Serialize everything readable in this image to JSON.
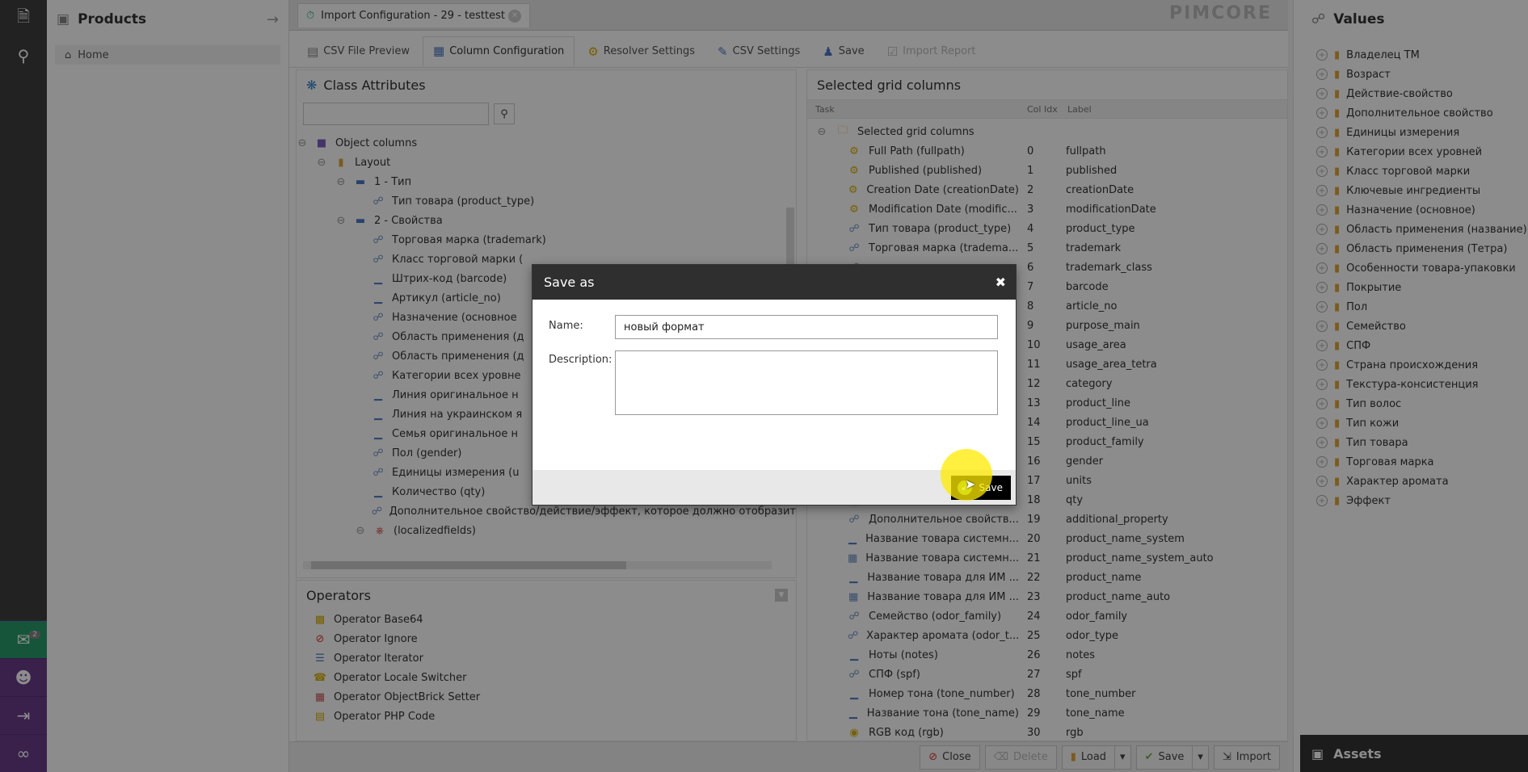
{
  "app": {
    "left_panel_title": "Products",
    "home_label": "Home",
    "active_tab_title": "Import Configuration - 29 - testtest",
    "logo": "PIMCORE",
    "comments_badge": "2"
  },
  "subtabs": [
    {
      "label": "CSV File Preview"
    },
    {
      "label": "Column Configuration"
    },
    {
      "label": "Resolver Settings"
    },
    {
      "label": "CSV Settings"
    },
    {
      "label": "Save"
    },
    {
      "label": "Import Report"
    }
  ],
  "class_attributes": {
    "title": "Class Attributes",
    "tree": [
      {
        "label": "Object columns",
        "icon": "cube-icon"
      },
      {
        "label": "Layout",
        "icon": "folder-icon"
      },
      {
        "label": "1 - Тип",
        "icon": "layout-icon"
      },
      {
        "label": "Тип товара (product_type)",
        "icon": "relation-icon"
      },
      {
        "label": "2 - Свойства",
        "icon": "layout-icon"
      },
      {
        "label": "Торговая марка (trademark)",
        "icon": "relation-icon"
      },
      {
        "label": "Класс торговой марки (",
        "icon": "relation-icon"
      },
      {
        "label": "Штрих-код (barcode)",
        "icon": "input-icon"
      },
      {
        "label": "Артикул (article_no)",
        "icon": "input-icon"
      },
      {
        "label": "Назначение (основное",
        "icon": "relation-icon"
      },
      {
        "label": "Область применения (д",
        "icon": "relation-icon"
      },
      {
        "label": "Область применения (д",
        "icon": "relation-icon"
      },
      {
        "label": "Категории всех уровне",
        "icon": "relation-icon"
      },
      {
        "label": "Линия оригинальное н",
        "icon": "input-icon"
      },
      {
        "label": "Линия на украинском я",
        "icon": "input-icon"
      },
      {
        "label": "Семья оригинальное н",
        "icon": "input-icon"
      },
      {
        "label": "Пол (gender)",
        "icon": "relation-icon"
      },
      {
        "label": "Единицы измерения (u",
        "icon": "relation-icon"
      },
      {
        "label": "Количество (qty)",
        "icon": "input-icon"
      },
      {
        "label": "Дополнительное свойство/действие/эффект, которое должно отобразит",
        "icon": "relation-icon"
      },
      {
        "label": "(localizedfields)",
        "icon": "localized-icon"
      }
    ]
  },
  "operators": {
    "title": "Operators",
    "items": [
      {
        "label": "Operator Base64"
      },
      {
        "label": "Operator Ignore"
      },
      {
        "label": "Operator Iterator"
      },
      {
        "label": "Operator Locale Switcher"
      },
      {
        "label": "Operator ObjectBrick Setter"
      },
      {
        "label": "Operator PHP Code"
      }
    ]
  },
  "selected_grid": {
    "title": "Selected grid columns",
    "headers": {
      "task": "Task",
      "col": "Col Idx",
      "label": "Label"
    },
    "root": "Selected grid columns",
    "rows": [
      {
        "task": "Full Path (fullpath)",
        "idx": "0",
        "label": "fullpath",
        "icon": "gear-icon"
      },
      {
        "task": "Published (published)",
        "idx": "1",
        "label": "published",
        "icon": "gear-icon"
      },
      {
        "task": "Creation Date (creationDate)",
        "idx": "2",
        "label": "creationDate",
        "icon": "gear-icon"
      },
      {
        "task": "Modification Date (modific...",
        "idx": "3",
        "label": "modificationDate",
        "icon": "gear-icon"
      },
      {
        "task": "Тип товара (product_type)",
        "idx": "4",
        "label": "product_type",
        "icon": "relation-icon"
      },
      {
        "task": "Торговая марка (tradema...",
        "idx": "5",
        "label": "trademark",
        "icon": "relation-icon"
      },
      {
        "task": "",
        "idx": "6",
        "label": "trademark_class",
        "icon": "relation-icon"
      },
      {
        "task": "",
        "idx": "7",
        "label": "barcode",
        "icon": "input-icon"
      },
      {
        "task": "",
        "idx": "8",
        "label": "article_no",
        "icon": "input-icon"
      },
      {
        "task": "",
        "idx": "9",
        "label": "purpose_main",
        "icon": "relation-icon"
      },
      {
        "task": "",
        "idx": "10",
        "label": "usage_area",
        "icon": "relation-icon"
      },
      {
        "task": "",
        "idx": "11",
        "label": "usage_area_tetra",
        "icon": "relation-icon"
      },
      {
        "task": "",
        "idx": "12",
        "label": "category",
        "icon": "relation-icon"
      },
      {
        "task": "",
        "idx": "13",
        "label": "product_line",
        "icon": "input-icon"
      },
      {
        "task": "",
        "idx": "14",
        "label": "product_line_ua",
        "icon": "input-icon"
      },
      {
        "task": "",
        "idx": "15",
        "label": "product_family",
        "icon": "input-icon"
      },
      {
        "task": "",
        "idx": "16",
        "label": "gender",
        "icon": "relation-icon"
      },
      {
        "task": "",
        "idx": "17",
        "label": "units",
        "icon": "relation-icon"
      },
      {
        "task": "Количество (qty)",
        "idx": "18",
        "label": "qty",
        "icon": "input-icon"
      },
      {
        "task": "Дополнительное свойств...",
        "idx": "19",
        "label": "additional_property",
        "icon": "relation-icon"
      },
      {
        "task": "Название товара системн...",
        "idx": "20",
        "label": "product_name_system",
        "icon": "input-icon"
      },
      {
        "task": "Название товара системн...",
        "idx": "21",
        "label": "product_name_system_auto",
        "icon": "calc-icon"
      },
      {
        "task": "Название товара для ИМ ...",
        "idx": "22",
        "label": "product_name",
        "icon": "input-icon"
      },
      {
        "task": "Название товара для ИМ ...",
        "idx": "23",
        "label": "product_name_auto",
        "icon": "calc-icon"
      },
      {
        "task": "Семейство (odor_family)",
        "idx": "24",
        "label": "odor_family",
        "icon": "relation-icon"
      },
      {
        "task": "Характер аромата (odor_t...",
        "idx": "25",
        "label": "odor_type",
        "icon": "relation-icon"
      },
      {
        "task": "Ноты (notes)",
        "idx": "26",
        "label": "notes",
        "icon": "input-icon"
      },
      {
        "task": "СПФ (spf)",
        "idx": "27",
        "label": "spf",
        "icon": "relation-icon"
      },
      {
        "task": "Номер тона (tone_number)",
        "idx": "28",
        "label": "tone_number",
        "icon": "input-icon"
      },
      {
        "task": "Название тона (tone_name)",
        "idx": "29",
        "label": "tone_name",
        "icon": "input-icon"
      },
      {
        "task": "RGB код (rgb)",
        "idx": "30",
        "label": "rgb",
        "icon": "color-icon"
      }
    ]
  },
  "toolbar": {
    "close": "Close",
    "delete": "Delete",
    "load": "Load",
    "save": "Save",
    "import": "Import"
  },
  "values_panel": {
    "title": "Values",
    "items": [
      "Владелец ТМ",
      "Возраст",
      "Действие-свойство",
      "Дополнительное свойство",
      "Единицы измерения",
      "Категории всех уровней",
      "Класс торговой марки",
      "Ключевые ингредиенты",
      "Назначение (основное)",
      "Область применения (название)",
      "Область применения (Тетра)",
      "Особенности товара-упаковки",
      "Покрытие",
      "Пол",
      "Семейство",
      "СПФ",
      "Страна происхождения",
      "Текстура-консистенция",
      "Тип волос",
      "Тип кожи",
      "Тип товара",
      "Торговая марка",
      "Характер аромата",
      "Эффект"
    ],
    "assets_label": "Assets"
  },
  "dialog": {
    "title": "Save as",
    "name_label": "Name:",
    "name_value": "новый формат",
    "description_label": "Description:",
    "description_value": "",
    "save_label": "Save"
  }
}
